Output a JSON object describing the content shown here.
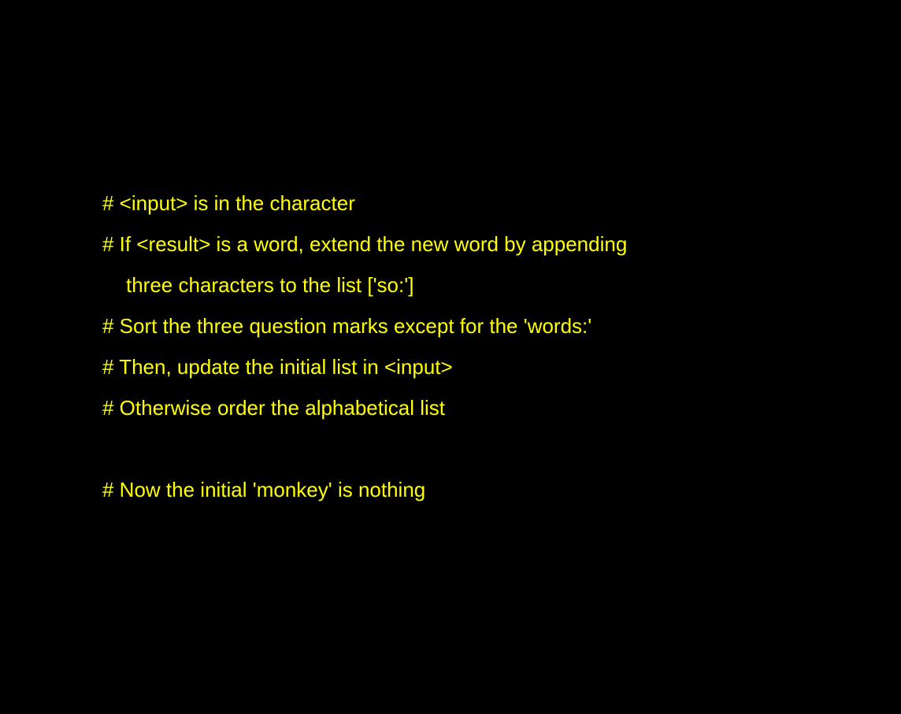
{
  "text_color": "#ffff00",
  "background_color": "#000000",
  "lines": [
    "# <input> is in the character",
    "# If <result> is a word, extend the new word by appending",
    "three characters to the list ['so:']",
    "# Sort the three question marks except for the 'words:'",
    "# Then, update the initial list in <input>",
    "# Otherwise order the alphabetical list",
    "# Now the initial 'monkey' is nothing"
  ]
}
